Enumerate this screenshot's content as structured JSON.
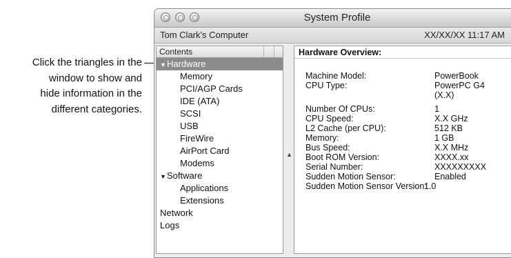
{
  "callout": {
    "line1": "Click the triangles in the",
    "line2": "window to show and",
    "line3": "hide information in the",
    "line4": "different categories."
  },
  "window": {
    "title": "System Profile",
    "computer_name": "Tom Clark's Computer",
    "datetime": "XX/XX/XX 11:17 AM"
  },
  "sidebar": {
    "header": "Contents",
    "items": [
      {
        "label": "Hardware",
        "level": 0,
        "expandable": true,
        "expanded": true,
        "selected": true
      },
      {
        "label": "Memory",
        "level": 1
      },
      {
        "label": "PCI/AGP Cards",
        "level": 1
      },
      {
        "label": "IDE (ATA)",
        "level": 1
      },
      {
        "label": "SCSI",
        "level": 1
      },
      {
        "label": "USB",
        "level": 1
      },
      {
        "label": "FireWire",
        "level": 1
      },
      {
        "label": "AirPort Card",
        "level": 1
      },
      {
        "label": "Modems",
        "level": 1
      },
      {
        "label": "Software",
        "level": 0,
        "expandable": true,
        "expanded": true
      },
      {
        "label": "Applications",
        "level": 1
      },
      {
        "label": "Extensions",
        "level": 1
      },
      {
        "label": "Network",
        "level": 0
      },
      {
        "label": "Logs",
        "level": 0
      }
    ],
    "triangle_glyph": "▼"
  },
  "detail": {
    "title": "Hardware Overview:",
    "rows": [
      {
        "key": "Machine Model:",
        "value": "PowerBook"
      },
      {
        "key": "CPU Type:",
        "value": "PowerPC G4"
      },
      {
        "key": "",
        "value": "(X.X)"
      },
      {
        "key": "Number Of CPUs:",
        "value": "1"
      },
      {
        "key": "CPU Speed:",
        "value": "X.X GHz"
      },
      {
        "key": "L2 Cache (per CPU):",
        "value": "512 KB"
      },
      {
        "key": "Memory:",
        "value": "1 GB"
      },
      {
        "key": "Bus Speed:",
        "value": "X.X MHz"
      },
      {
        "key": "Boot ROM Version:",
        "value": "XXXX.xx"
      },
      {
        "key": "Serial Number:",
        "value": "XXXXXXXXX"
      },
      {
        "key": "Sudden Motion Sensor:",
        "value": "Enabled"
      },
      {
        "key": "Sudden Motion Sensor Version:",
        "value": "1.0"
      }
    ]
  },
  "colors": {
    "selection": "#8c8c8c",
    "window_bg": "#ececec"
  }
}
